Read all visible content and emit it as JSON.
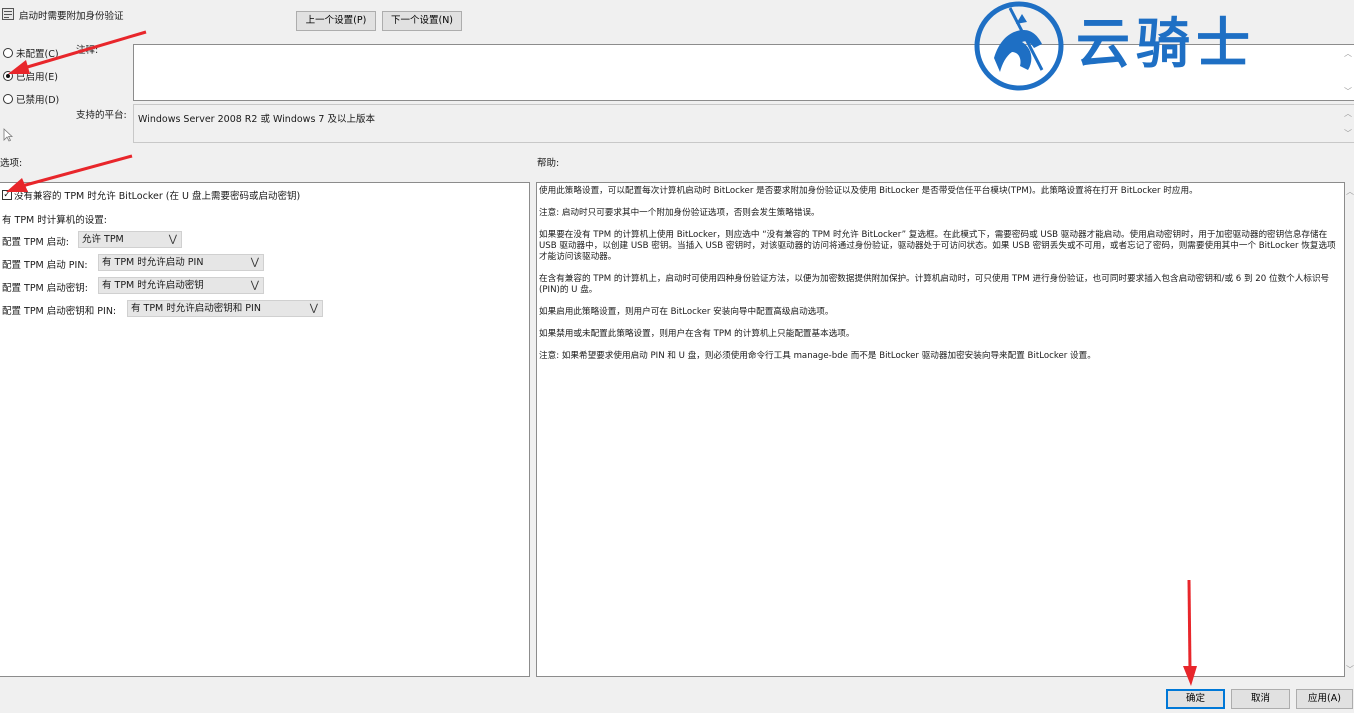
{
  "window": {
    "title": "启动时需要附加身份验证",
    "prev_button": "上一个设置(P)",
    "next_button": "下一个设置(N)"
  },
  "state": {
    "not_configured": "未配置(C)",
    "enabled": "已启用(E)",
    "disabled": "已禁用(D)",
    "selected": "enabled"
  },
  "comment": {
    "label": "注释:",
    "value": ""
  },
  "platform": {
    "label": "支持的平台:",
    "value": "Windows Server 2008 R2 或 Windows 7 及以上版本"
  },
  "options": {
    "header": "选项:",
    "allow_without_tpm": "没有兼容的 TPM 时允许 BitLocker (在 U 盘上需要密码或启动密钥)",
    "allow_without_tpm_checked": true,
    "tpm_settings_label": "有 TPM 时计算机的设置:",
    "rows": [
      {
        "label": "配置 TPM 启动:",
        "value": "允许 TPM"
      },
      {
        "label": "配置 TPM 启动 PIN:",
        "value": "有 TPM 时允许启动 PIN"
      },
      {
        "label": "配置 TPM 启动密钥:",
        "value": "有 TPM 时允许启动密钥"
      },
      {
        "label": "配置 TPM 启动密钥和 PIN:",
        "value": "有 TPM 时允许启动密钥和 PIN"
      }
    ]
  },
  "help": {
    "header": "帮助:",
    "paragraphs": [
      "使用此策略设置，可以配置每次计算机启动时 BitLocker 是否要求附加身份验证以及使用 BitLocker 是否带受信任平台模块(TPM)。此策略设置将在打开 BitLocker 时应用。",
      "注意: 启动时只可要求其中一个附加身份验证选项，否则会发生策略错误。",
      "如果要在没有 TPM 的计算机上使用 BitLocker，则应选中 “没有兼容的 TPM 时允许 BitLocker” 复选框。在此模式下，需要密码或 USB 驱动器才能启动。使用启动密钥时，用于加密驱动器的密钥信息存储在 USB 驱动器中，以创建 USB 密钥。当插入 USB 密钥时，对该驱动器的访问将通过身份验证，驱动器处于可访问状态。如果 USB 密钥丢失或不可用，或者忘记了密码，则需要使用其中一个 BitLocker 恢复选项才能访问该驱动器。",
      "在含有兼容的 TPM 的计算机上，启动时可使用四种身份验证方法，以便为加密数据提供附加保护。计算机启动时，可只使用 TPM 进行身份验证，也可同时要求插入包含启动密钥和/或 6 到 20 位数个人标识号(PIN)的 U 盘。",
      "如果启用此策略设置，则用户可在 BitLocker 安装向导中配置高级启动选项。",
      "如果禁用或未配置此策略设置，则用户在含有 TPM 的计算机上只能配置基本选项。",
      "注意: 如果希望要求使用启动 PIN 和 U 盘，则必须使用命令行工具 manage-bde 而不是 BitLocker 驱动器加密安装向导来配置 BitLocker 设置。"
    ]
  },
  "footer": {
    "ok": "确定",
    "cancel": "取消",
    "apply": "应用(A)"
  },
  "watermark": {
    "text": "云骑士",
    "color": "#1e6fc4"
  },
  "accent": {
    "arrow": "#e8262b",
    "focus": "#0078d7"
  }
}
